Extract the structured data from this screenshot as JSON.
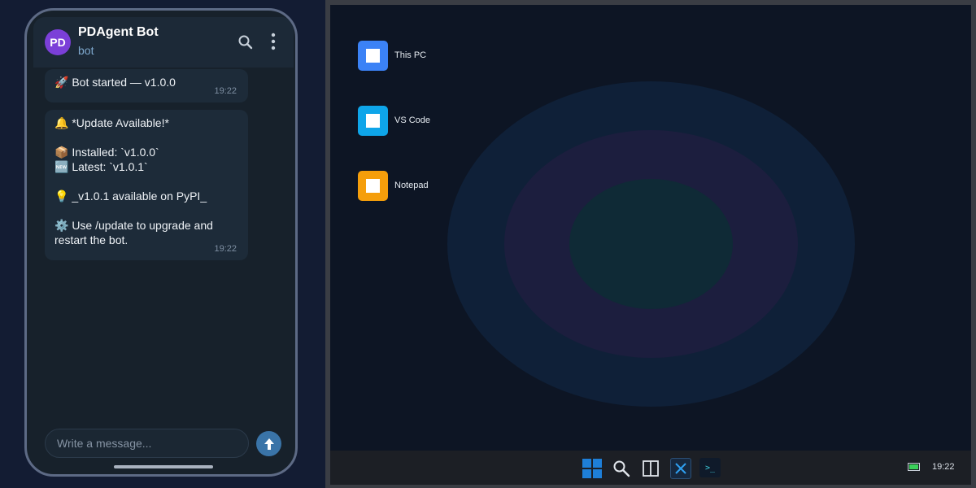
{
  "chat": {
    "avatar_initials": "PD",
    "title": "PDAgent Bot",
    "status": "bot",
    "messages": [
      {
        "lines": [
          "🚀 Bot started — v1.0.0"
        ],
        "time": "19:22"
      },
      {
        "lines": [
          "🔔 *Update Available!*",
          "",
          "📦 Installed: `v1.0.0`",
          "🆕 Latest: `v1.0.1`",
          "",
          "💡 _v1.0.1 available on PyPI_",
          "",
          "⚙️ Use /update to upgrade and restart the bot."
        ],
        "time": "19:22"
      }
    ],
    "composer_placeholder": "Write a message...",
    "icons": {
      "search": "search-icon",
      "menu": "more-vertical-icon",
      "send": "send-arrow-icon"
    }
  },
  "desktop": {
    "icons": [
      {
        "label": "This PC",
        "color": "#3b82f6",
        "icon": "computer-icon"
      },
      {
        "label": "VS Code",
        "color": "#0ea5e9",
        "icon": "code-editor-icon"
      },
      {
        "label": "Notepad",
        "color": "#f59e0b",
        "icon": "notepad-icon"
      }
    ],
    "taskbar": {
      "items": [
        "start-icon",
        "search-icon",
        "task-view-icon",
        "code-editor-icon",
        "terminal-icon"
      ],
      "terminal_glyph": ">_",
      "clock": "19:22"
    }
  }
}
